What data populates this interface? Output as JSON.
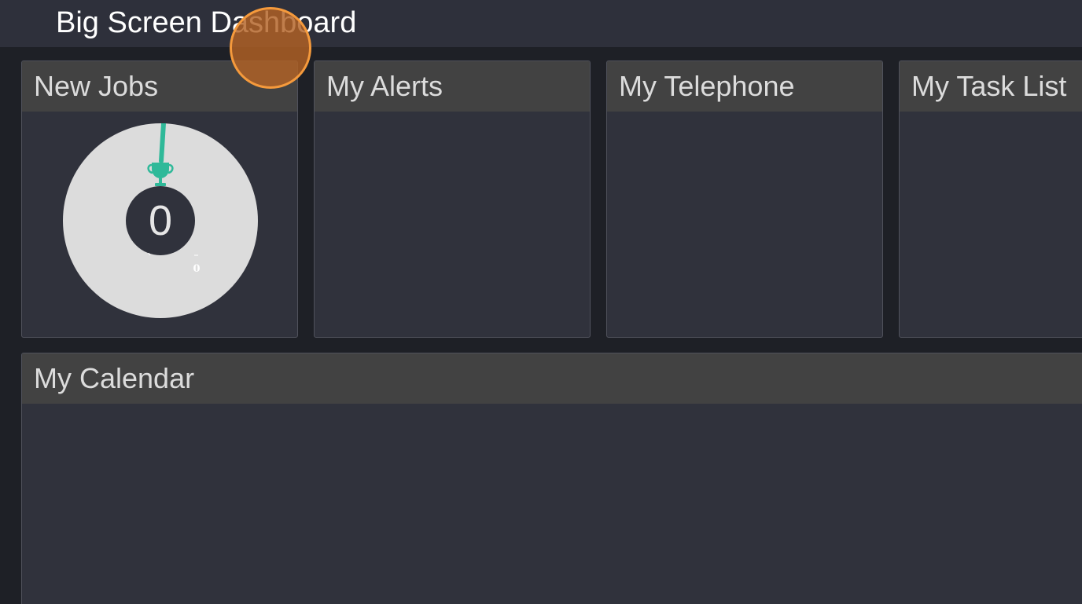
{
  "header": {
    "title": "Big Screen Dashboard"
  },
  "panels": {
    "jobs": {
      "title": "New Jobs",
      "gauge": {
        "value": "0",
        "min_label": "0",
        "level": 0,
        "track_color": "#dcdcdc",
        "needle_color": "#2fb999",
        "icon": "trophy-icon"
      }
    },
    "alerts": {
      "title": "My Alerts"
    },
    "telephone": {
      "title": "My Telephone"
    },
    "tasks": {
      "title": "My Task List"
    },
    "calendar": {
      "title": "My Calendar"
    }
  },
  "theme": {
    "background": "#1e2026",
    "topbar": "#2e303b",
    "panel_body": "#30323c",
    "panel_header": "#424242",
    "accent": "#2fb999",
    "cursor": "#f59a3c"
  }
}
